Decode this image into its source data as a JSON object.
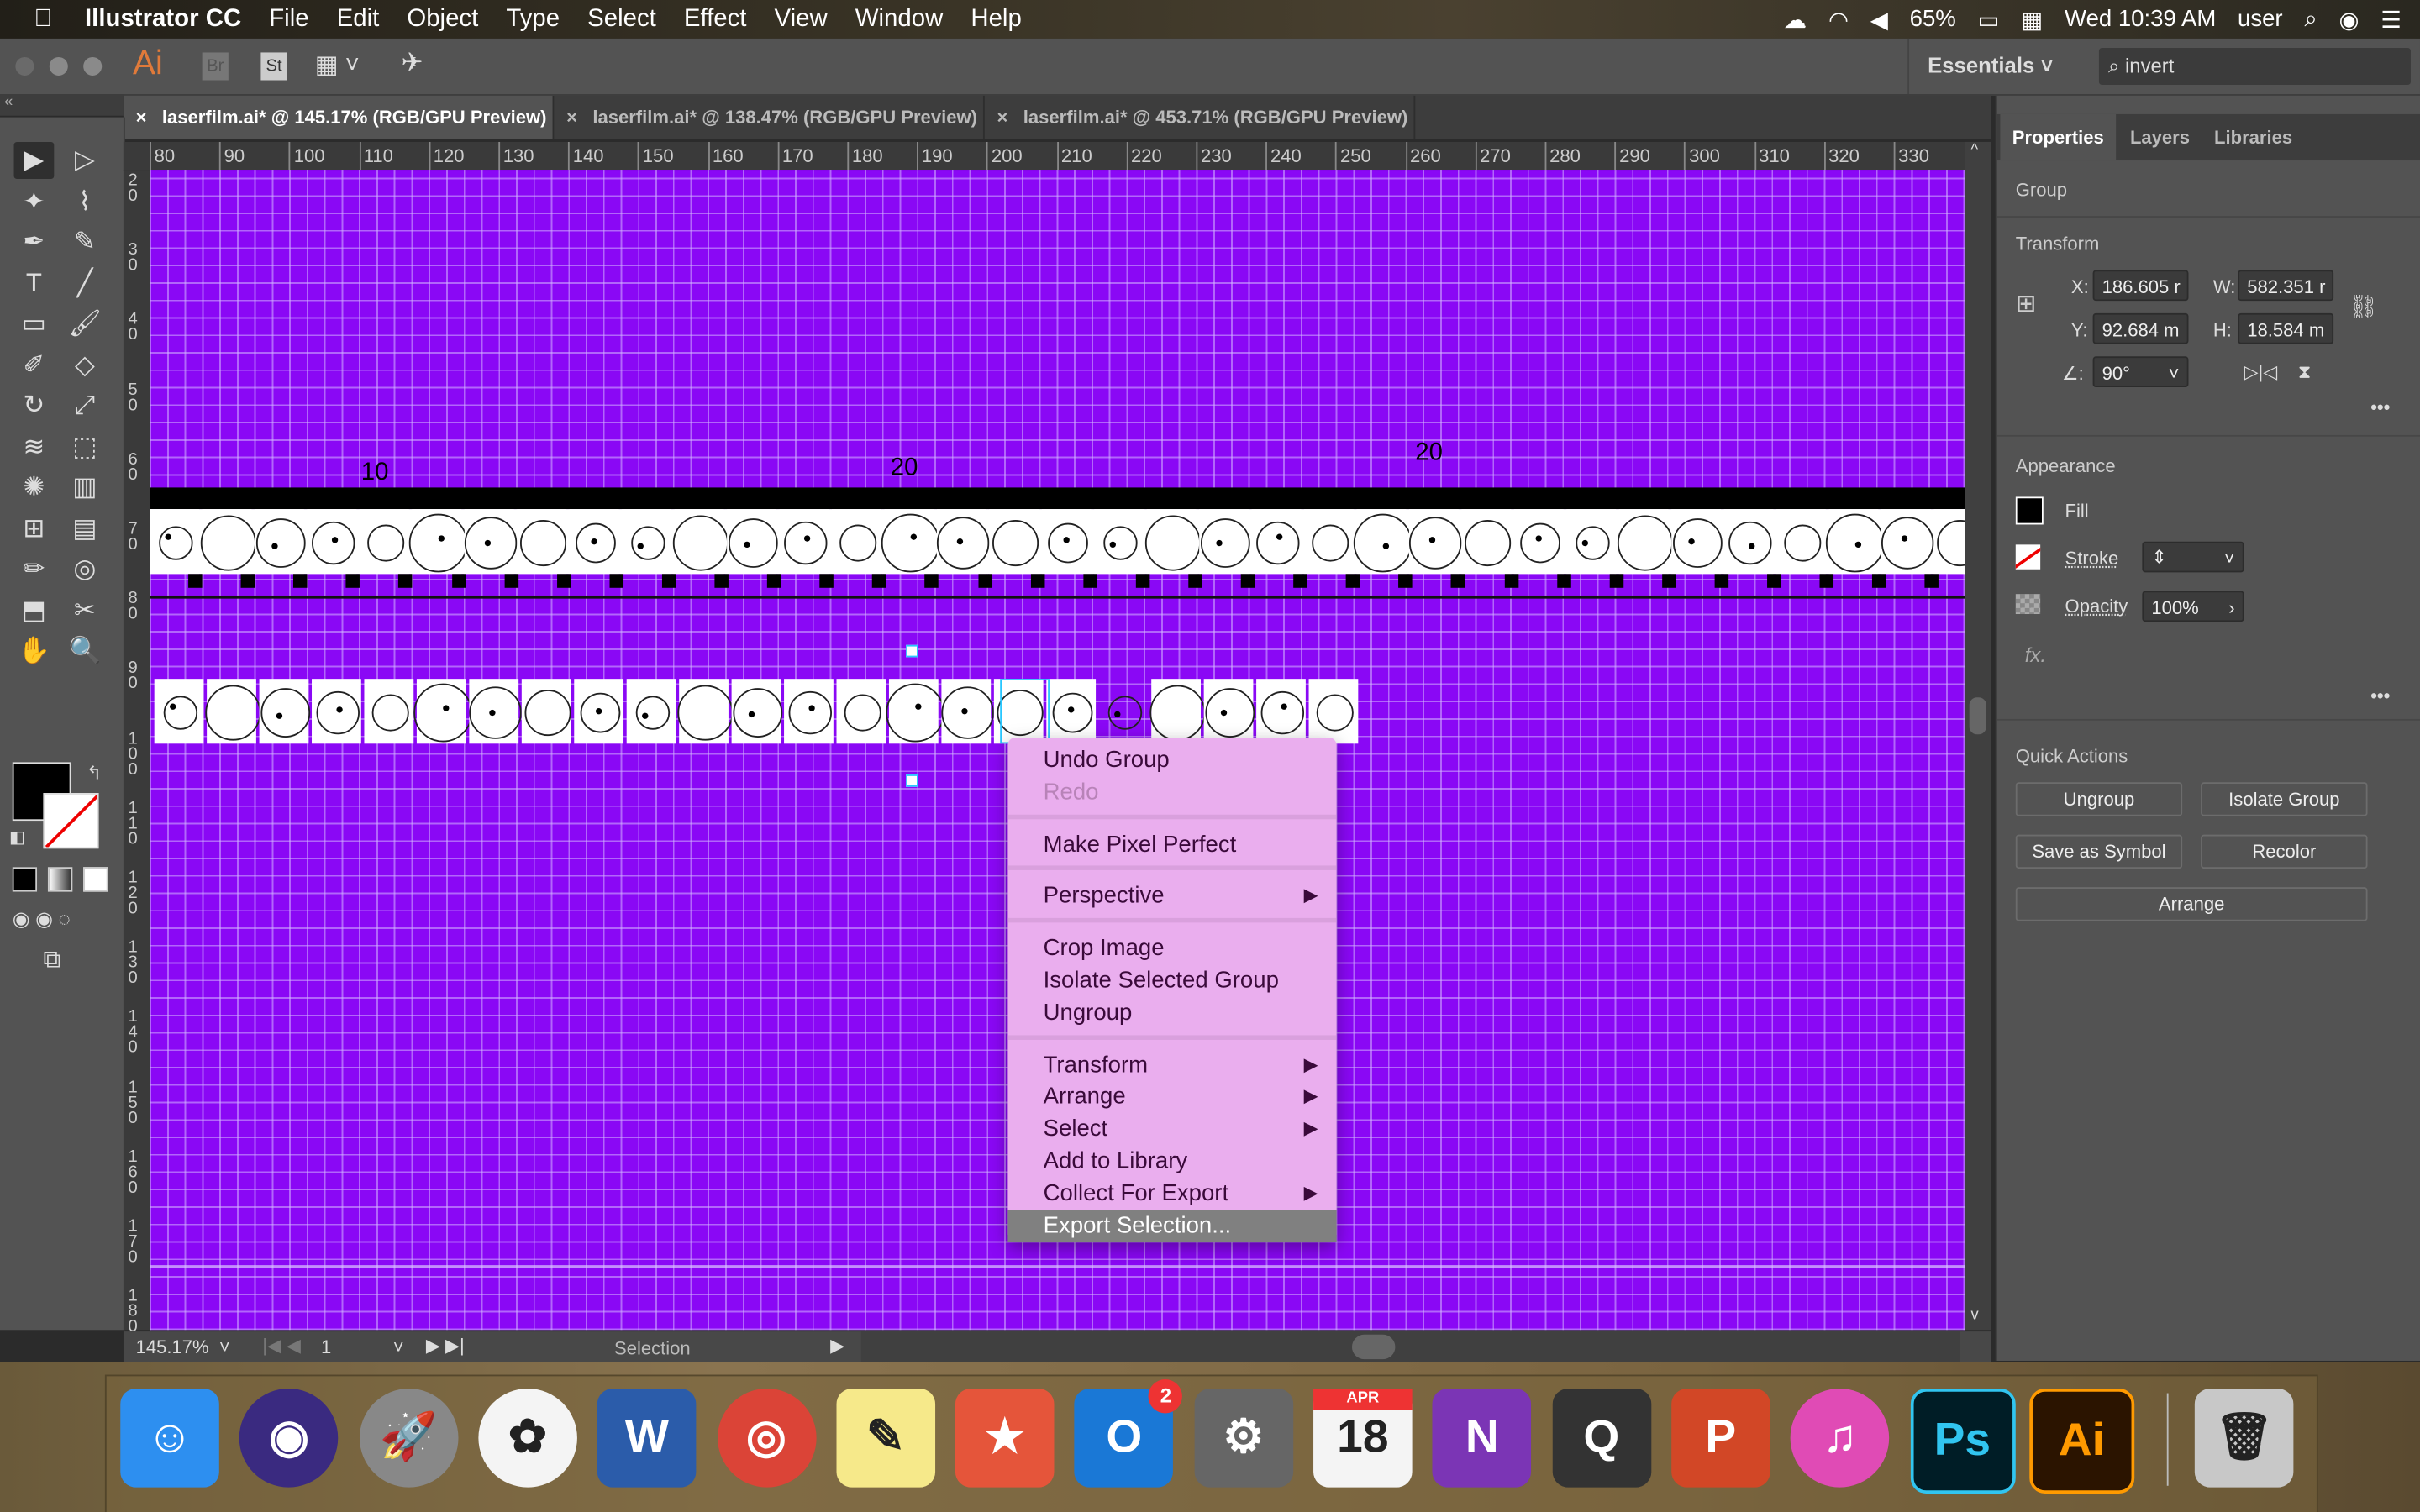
{
  "menubar": {
    "app": "Illustrator CC",
    "items": [
      "File",
      "Edit",
      "Object",
      "Type",
      "Select",
      "Effect",
      "View",
      "Window",
      "Help"
    ],
    "battery": "65%",
    "clock": "Wed 10:39 AM",
    "user": "user"
  },
  "apptoolbar": {
    "logo": "Ai",
    "bridge": "Br",
    "stock": "St",
    "workspace": "Essentials",
    "search_value": "invert"
  },
  "tabs": [
    {
      "label": "laserfilm.ai* @ 145.17% (RGB/GPU Preview)",
      "active": true
    },
    {
      "label": "laserfilm.ai* @ 138.47% (RGB/GPU Preview)",
      "active": false
    },
    {
      "label": "laserfilm.ai* @ 453.71% (RGB/GPU Preview)",
      "active": false
    }
  ],
  "ruler_top": [
    "80",
    "90",
    "100",
    "110",
    "120",
    "130",
    "140",
    "150",
    "160",
    "170",
    "180",
    "190",
    "200",
    "210",
    "220",
    "230",
    "240",
    "250",
    "260",
    "270",
    "280",
    "290",
    "300",
    "310",
    "320",
    "330"
  ],
  "ruler_left": [
    "2 0",
    "3 0",
    "4 0",
    "5 0",
    "6 0",
    "7 0",
    "8 0",
    "9 0",
    "1 0 0",
    "1 1 0",
    "1 2 0",
    "1 3 0",
    "1 4 0",
    "1 5 0",
    "1 6 0",
    "1 7 0",
    "1 8 0"
  ],
  "canvas": {
    "labels": [
      "10",
      "20",
      "20"
    ],
    "canvas_color": "#8a08f5"
  },
  "tools": [
    "selection-tool",
    "direct-selection-tool",
    "magic-wand-tool",
    "lasso-tool",
    "pen-tool",
    "curvature-tool",
    "type-tool",
    "line-tool",
    "rectangle-tool",
    "paintbrush-tool",
    "shaper-tool",
    "eraser-tool",
    "rotate-tool",
    "scale-tool",
    "warp-tool",
    "free-transform-tool",
    "symbol-sprayer-tool",
    "column-graph-tool",
    "mesh-tool",
    "gradient-tool",
    "eyedropper-tool",
    "blend-tool",
    "artboard-tool",
    "slice-tool",
    "hand-tool",
    "zoom-tool"
  ],
  "tool_glyphs": [
    "▶",
    "▷",
    "✦",
    "⌇",
    "✒",
    "✎",
    "T",
    "╱",
    "▭",
    "🖌",
    "✐",
    "◇",
    "↻",
    "⤢",
    "≋",
    "⬚",
    "✺",
    "▥",
    "⊞",
    "▤",
    "✏",
    "◎",
    "⬒",
    "✂",
    "✋",
    "🔍"
  ],
  "statusbar": {
    "zoom": "145.17%",
    "artboard": "1",
    "tool": "Selection"
  },
  "properties": {
    "tabs": [
      "Properties",
      "Layers",
      "Libraries"
    ],
    "selection_type": "Group",
    "transform": {
      "title": "Transform",
      "x_label": "X:",
      "x": "186.605 r",
      "y_label": "Y:",
      "y": "92.684 m",
      "w_label": "W:",
      "w": "582.351 r",
      "h_label": "H:",
      "h": "18.584 m",
      "angle_label": "∠:",
      "angle": "90°"
    },
    "appearance": {
      "title": "Appearance",
      "fill": "Fill",
      "stroke": "Stroke",
      "opacity_label": "Opacity",
      "opacity": "100%",
      "fx": "fx."
    },
    "quick_actions": {
      "title": "Quick Actions",
      "buttons": [
        "Ungroup",
        "Isolate Group",
        "Save as Symbol",
        "Recolor",
        "Arrange"
      ]
    }
  },
  "context_menu": {
    "items": [
      {
        "label": "Undo Group"
      },
      {
        "label": "Redo",
        "disabled": true
      },
      {
        "label": "Make Pixel Perfect"
      },
      {
        "label": "Perspective",
        "submenu": true
      },
      {
        "label": "Crop Image"
      },
      {
        "label": "Isolate Selected Group"
      },
      {
        "label": "Ungroup"
      },
      {
        "label": "Transform",
        "submenu": true
      },
      {
        "label": "Arrange",
        "submenu": true
      },
      {
        "label": "Select",
        "submenu": true
      },
      {
        "label": "Add to Library"
      },
      {
        "label": "Collect For Export",
        "submenu": true
      },
      {
        "label": "Export Selection...",
        "highlighted": true
      }
    ],
    "arrow": "▶",
    "bg_color": "#eaaeee"
  },
  "dock": {
    "apps": [
      {
        "name": "finder",
        "glyph": "☺",
        "color": "#2d8ff0"
      },
      {
        "name": "siri",
        "glyph": "◉",
        "color": "#3a2a80"
      },
      {
        "name": "launchpad",
        "glyph": "🚀",
        "color": "#888"
      },
      {
        "name": "photos",
        "glyph": "✿",
        "color": "#f4f4f4"
      },
      {
        "name": "word",
        "glyph": "W",
        "color": "#2b5caa"
      },
      {
        "name": "chrome",
        "glyph": "◎",
        "color": "#db4437"
      },
      {
        "name": "stickies",
        "glyph": "✎",
        "color": "#f6e98a"
      },
      {
        "name": "wunderlist",
        "glyph": "★",
        "color": "#e5553a"
      },
      {
        "name": "outlook",
        "glyph": "O",
        "color": "#1a78d6",
        "badge": "2"
      },
      {
        "name": "system-preferences",
        "glyph": "⚙",
        "color": "#666"
      },
      {
        "name": "calendar",
        "glyph": "18",
        "color": "#f4f4f4",
        "month": "APR"
      },
      {
        "name": "onenote",
        "glyph": "N",
        "color": "#7b35b5"
      },
      {
        "name": "quicktime",
        "glyph": "Q",
        "color": "#333"
      },
      {
        "name": "powerpoint",
        "glyph": "P",
        "color": "#d24726"
      },
      {
        "name": "itunes",
        "glyph": "♫",
        "color": "#e04bb5"
      },
      {
        "name": "photoshop",
        "glyph": "Ps",
        "color": "#001d26"
      },
      {
        "name": "illustrator",
        "glyph": "Ai",
        "color": "#2b1400"
      },
      {
        "name": "trash",
        "glyph": "🗑",
        "color": "#c8c8c8"
      }
    ]
  }
}
